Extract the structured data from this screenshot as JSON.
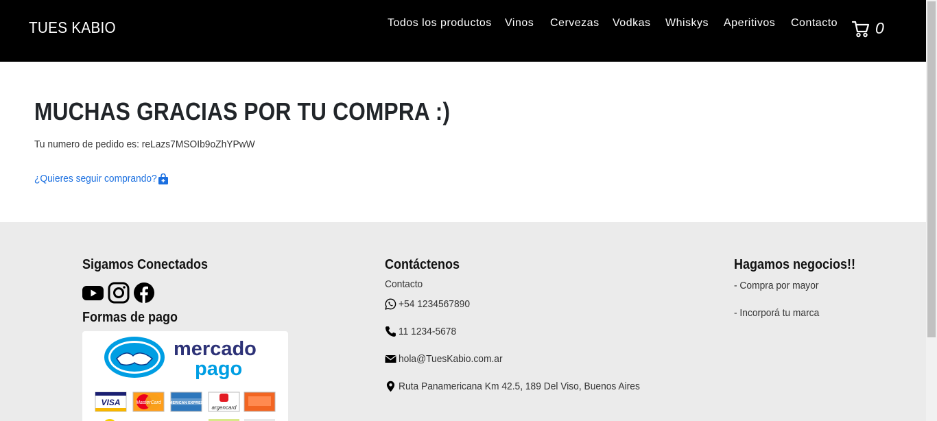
{
  "header": {
    "brand": "TUES KABIO",
    "nav": [
      "Todos los productos",
      "Vinos",
      "Cervezas",
      "Vodkas",
      "Whiskys",
      "Aperitivos",
      "Contacto"
    ],
    "cart_count": "0"
  },
  "main": {
    "title": "MUCHAS GRACIAS POR TU COMPRA :)",
    "order_label": "Tu numero de pedido es: reLazs7MSOIb9oZhYPwW",
    "continue_link": "¿Quieres seguir comprando?"
  },
  "footer": {
    "social": {
      "heading": "Sigamos Conectados",
      "icons": [
        "youtube-icon",
        "instagram-icon",
        "facebook-icon"
      ]
    },
    "payment": {
      "heading": "Formas de pago",
      "logo_line1": "mercado",
      "logo_line2": "pago",
      "cards": [
        "VISA",
        "MasterCard",
        "AMERICAN EXPRESS",
        "argencard",
        ""
      ]
    },
    "contact": {
      "heading": "Contáctenos",
      "link": "Contacto",
      "whatsapp": "+54 1234567890",
      "phone": "11 1234-5678",
      "email": "hola@TuesKabio.com.ar",
      "address": "Ruta Panamericana Km 42.5, 189 Del Viso, Buenos Aires"
    },
    "business": {
      "heading": "Hagamos negocios!!",
      "items": [
        "- Compra por mayor",
        "- Incorporá tu marca"
      ]
    }
  },
  "colors": {
    "header_bg": "#000000",
    "footer_bg": "#ebebeb",
    "link": "#1a6fe0",
    "mercadopago_blue": "#009ee3"
  }
}
